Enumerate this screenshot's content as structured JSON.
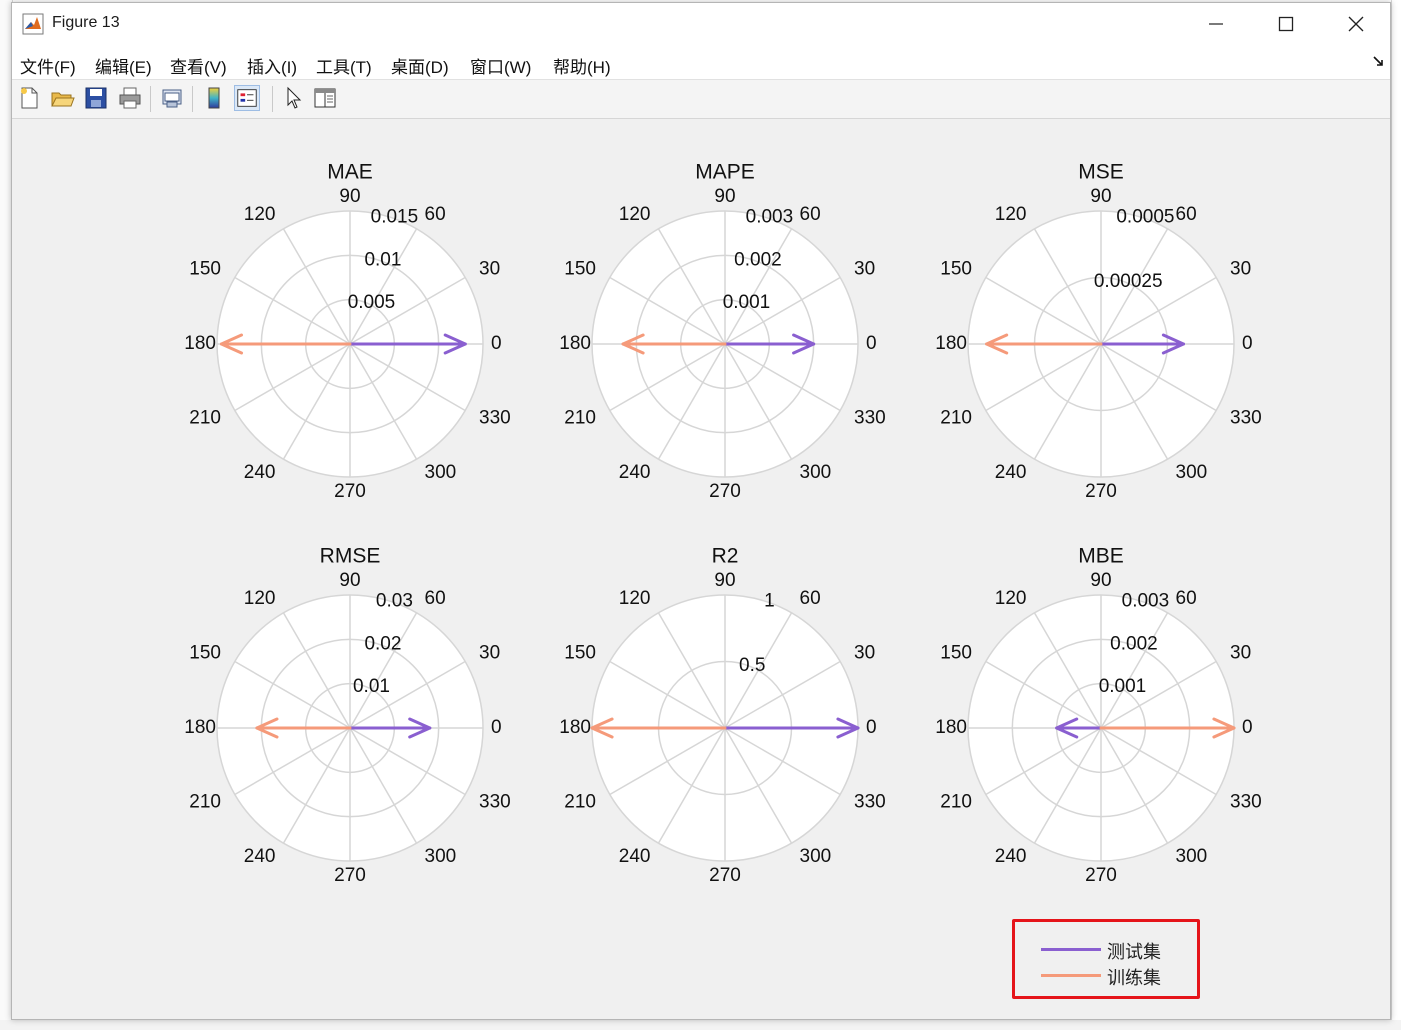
{
  "window": {
    "title": "Figure 13",
    "minimize_glyph": "—",
    "maximize_glyph": "☐",
    "close_glyph": "✕"
  },
  "menu": [
    {
      "label": "文件(F)"
    },
    {
      "label": "编辑(E)"
    },
    {
      "label": "查看(V)"
    },
    {
      "label": "插入(I)"
    },
    {
      "label": "工具(T)"
    },
    {
      "label": "桌面(D)"
    },
    {
      "label": "窗口(W)"
    },
    {
      "label": "帮助(H)"
    }
  ],
  "toolbar": [
    "new-figure-icon",
    "open-file-icon",
    "save-icon",
    "print-icon",
    "print-preview-icon",
    "colorbar-icon",
    "legend-icon",
    "select-arrow-icon",
    "property-editor-icon"
  ],
  "colors": {
    "test": "#8a5fd0",
    "train": "#f59a7a",
    "legend_border": "#e5141a",
    "grid": "#d6d6d6"
  },
  "chart_data": [
    {
      "type": "polar-compass",
      "title": "MAE",
      "rlim": [
        0,
        0.015
      ],
      "rticks": [
        0.005,
        0.01,
        0.015
      ],
      "rticklabels": [
        "0.005",
        "0.01",
        "0.015"
      ],
      "angle_ticks": [
        "0",
        "30",
        "60",
        "90",
        "120",
        "150",
        "180",
        "210",
        "240",
        "270",
        "300",
        "330"
      ],
      "series": [
        {
          "name": "测试集",
          "angle": 0,
          "magnitude": 0.013
        },
        {
          "name": "训练集",
          "angle": 180,
          "magnitude": 0.0145
        }
      ]
    },
    {
      "type": "polar-compass",
      "title": "MAPE",
      "rlim": [
        0,
        0.003
      ],
      "rticks": [
        0.001,
        0.002,
        0.003
      ],
      "rticklabels": [
        "0.001",
        "0.002",
        "0.003"
      ],
      "angle_ticks": [
        "0",
        "30",
        "60",
        "90",
        "120",
        "150",
        "180",
        "210",
        "240",
        "270",
        "300",
        "330"
      ],
      "series": [
        {
          "name": "测试集",
          "angle": 0,
          "magnitude": 0.002
        },
        {
          "name": "训练集",
          "angle": 180,
          "magnitude": 0.0023
        }
      ]
    },
    {
      "type": "polar-compass",
      "title": "MSE",
      "rlim": [
        0,
        0.0005
      ],
      "rticks": [
        0.00025,
        0.0005
      ],
      "rticklabels": [
        "0.00025",
        "0.0005"
      ],
      "angle_ticks": [
        "0",
        "30",
        "60",
        "90",
        "120",
        "150",
        "180",
        "210",
        "240",
        "270",
        "300",
        "330"
      ],
      "series": [
        {
          "name": "测试集",
          "angle": 0,
          "magnitude": 0.00031
        },
        {
          "name": "训练集",
          "angle": 180,
          "magnitude": 0.00043
        }
      ]
    },
    {
      "type": "polar-compass",
      "title": "RMSE",
      "rlim": [
        0,
        0.03
      ],
      "rticks": [
        0.01,
        0.02,
        0.03
      ],
      "rticklabels": [
        "0.01",
        "0.02",
        "0.03"
      ],
      "angle_ticks": [
        "0",
        "30",
        "60",
        "90",
        "120",
        "150",
        "180",
        "210",
        "240",
        "270",
        "300",
        "330"
      ],
      "series": [
        {
          "name": "测试集",
          "angle": 0,
          "magnitude": 0.018
        },
        {
          "name": "训练集",
          "angle": 180,
          "magnitude": 0.021
        }
      ]
    },
    {
      "type": "polar-compass",
      "title": "R2",
      "rlim": [
        0,
        1
      ],
      "rticks": [
        0.5,
        1
      ],
      "rticklabels": [
        "0.5",
        "1"
      ],
      "angle_ticks": [
        "0",
        "30",
        "60",
        "90",
        "120",
        "150",
        "180",
        "210",
        "240",
        "270",
        "300",
        "330"
      ],
      "series": [
        {
          "name": "测试集",
          "angle": 0,
          "magnitude": 1.0
        },
        {
          "name": "训练集",
          "angle": 180,
          "magnitude": 1.0
        }
      ]
    },
    {
      "type": "polar-compass",
      "title": "MBE",
      "rlim": [
        0,
        0.003
      ],
      "rticks": [
        0.001,
        0.002,
        0.003
      ],
      "rticklabels": [
        "0.001",
        "0.002",
        "0.003"
      ],
      "angle_ticks": [
        "0",
        "30",
        "60",
        "90",
        "120",
        "150",
        "180",
        "210",
        "240",
        "270",
        "300",
        "330"
      ],
      "series": [
        {
          "name": "测试集",
          "angle": 180,
          "magnitude": 0.001
        },
        {
          "name": "训练集",
          "angle": 0,
          "magnitude": 0.003
        }
      ]
    }
  ],
  "legend": {
    "items": [
      {
        "label": "测试集"
      },
      {
        "label": "训练集"
      }
    ]
  }
}
